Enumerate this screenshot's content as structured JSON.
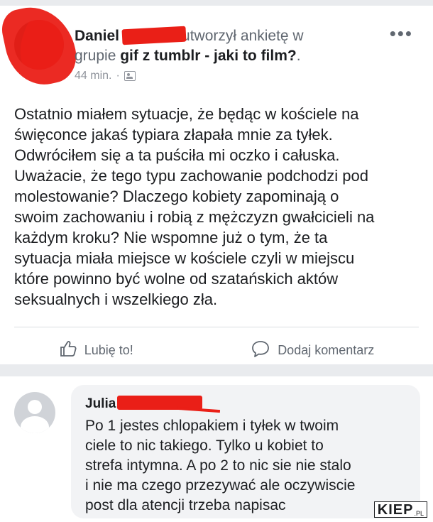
{
  "post": {
    "author": "Daniel",
    "action": "utworzył ankietę w",
    "group_prefix": "grupie",
    "group_name": "gif z tumblr - jaki to film?",
    "group_suffix": ".",
    "time": "44 min.",
    "separator": "·",
    "more_label": "•••",
    "text_lines": [
      "Ostatnio miałem sytuacje, że będąc w kościele na",
      "święconce jakaś typiara złapała mnie za tyłek.",
      "Odwróciłem się a ta puściła mi oczko i całuska.",
      "Uważacie, że tego typu zachowanie podchodzi pod",
      "molestowanie? Dlaczego kobiety zapominają o",
      "swoim zachowaniu i robią z mężczyzn gwałcicieli na",
      "każdym kroku? Nie wspomne już o tym, że ta",
      "sytuacja miała miejsce w kościele czyli w miejscu",
      "które powinno być wolne od szatańskich aktów",
      "seksualnych i wszelkiego zła."
    ],
    "like_label": "Lubię to!",
    "comment_label": "Dodaj komentarz"
  },
  "comment": {
    "author": "Julia",
    "text_lines": [
      "Po 1 jestes chlopakiem i tyłek w twoim",
      "ciele to nic takiego. Tylko u kobiet to",
      "strefa intymna. A po 2 to nic sie nie stalo",
      "i nie ma czego przezywać ale oczywiscie",
      "post dla atencji trzeba napisac"
    ]
  },
  "watermark": {
    "main": "KIEP",
    "sub": ".PL"
  },
  "icons": {
    "group": "group-icon",
    "like": "thumbs-up-icon",
    "comment": "speech-bubble-icon",
    "more": "more-options-icon"
  },
  "colors": {
    "redaction": "#ea1f17",
    "background": "#e9ebee",
    "secondary_text": "#606770"
  }
}
